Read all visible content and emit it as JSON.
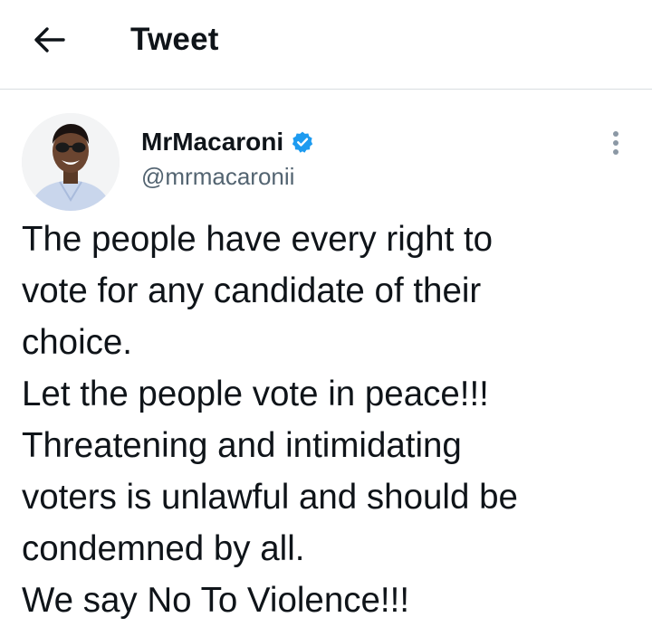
{
  "header": {
    "title": "Tweet",
    "back_icon": "arrow-left-icon"
  },
  "author": {
    "display_name": "MrMacaroni",
    "handle": "@mrmacaronii",
    "verified": true,
    "verified_color": "#1d9bf0",
    "avatar_icon": "user-avatar"
  },
  "tweet": {
    "lines": [
      "The people have every right to",
      "vote for any candidate of their",
      "choice.",
      "Let the people vote in peace!!!",
      "Threatening and intimidating",
      "voters is unlawful and should be",
      "condemned by all.",
      "We say No To Violence!!!"
    ]
  },
  "menu": {
    "more_icon": "more-vertical-icon"
  },
  "colors": {
    "text": "#0f1419",
    "secondary": "#536471",
    "divider": "#d9dde0"
  }
}
